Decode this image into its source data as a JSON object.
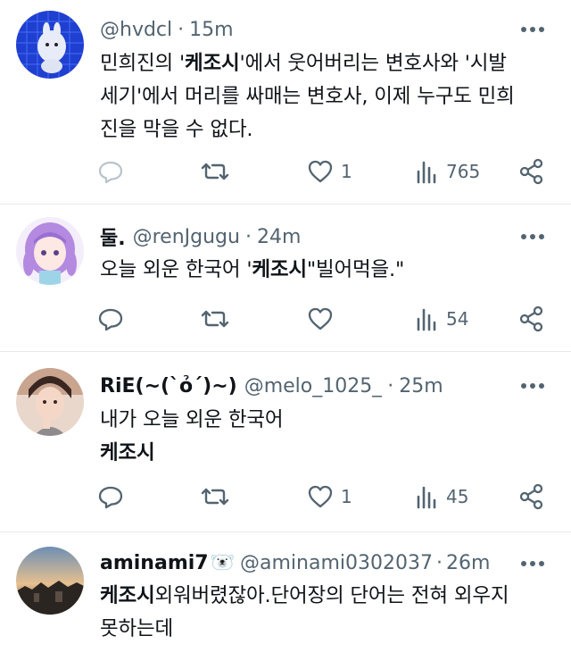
{
  "tweets": [
    {
      "name": "",
      "handle": "@hvdcl",
      "time": "15m",
      "line1_a": "민희진의 '",
      "line1_b": "케조시",
      "line1_c": "'에서 웃어버리는 변호사와 '시발",
      "line2": "세기'에서 머리를 싸매는 변호사, 이제 누구도 민희",
      "line3": "진을 막을 수 없다.",
      "reply_count": "",
      "retweet_count": "",
      "like_count": "1",
      "view_count": "765"
    },
    {
      "name": "둘.",
      "handle": "@renJgugu",
      "time": "24m",
      "line1_a": "오늘 외운 한국어 '",
      "line1_b": "케조시",
      "line1_c": "\"빌어먹을.\"",
      "reply_count": "",
      "retweet_count": "",
      "like_count": "",
      "view_count": "54"
    },
    {
      "name": "RiE(~(`ỏ´)~)",
      "handle": "@melo_1025_",
      "time": "25m",
      "line1": "내가 오늘 외운 한국어",
      "line2": "케조시",
      "reply_count": "",
      "retweet_count": "",
      "like_count": "1",
      "view_count": "45"
    },
    {
      "name": "aminami7",
      "name_emoji": "🐻‍❄️",
      "handle": "@aminami0302037",
      "time": "26m",
      "line1_a": "케조시",
      "line1_b": "외워버렸잖아.단어장의 단어는 전혀 외우지",
      "line2": "못하는데"
    }
  ],
  "icons": {
    "more": "more-horizontal-icon",
    "reply": "reply-bubble-icon",
    "retweet": "retweet-arrows-icon",
    "like": "heart-icon",
    "views": "views-bars-icon",
    "share": "share-nodes-icon"
  },
  "colors": {
    "text": "#0f1419",
    "secondary": "#536471",
    "divider": "#e6e9eb",
    "avatar1_bg": "#1f3fd0"
  }
}
